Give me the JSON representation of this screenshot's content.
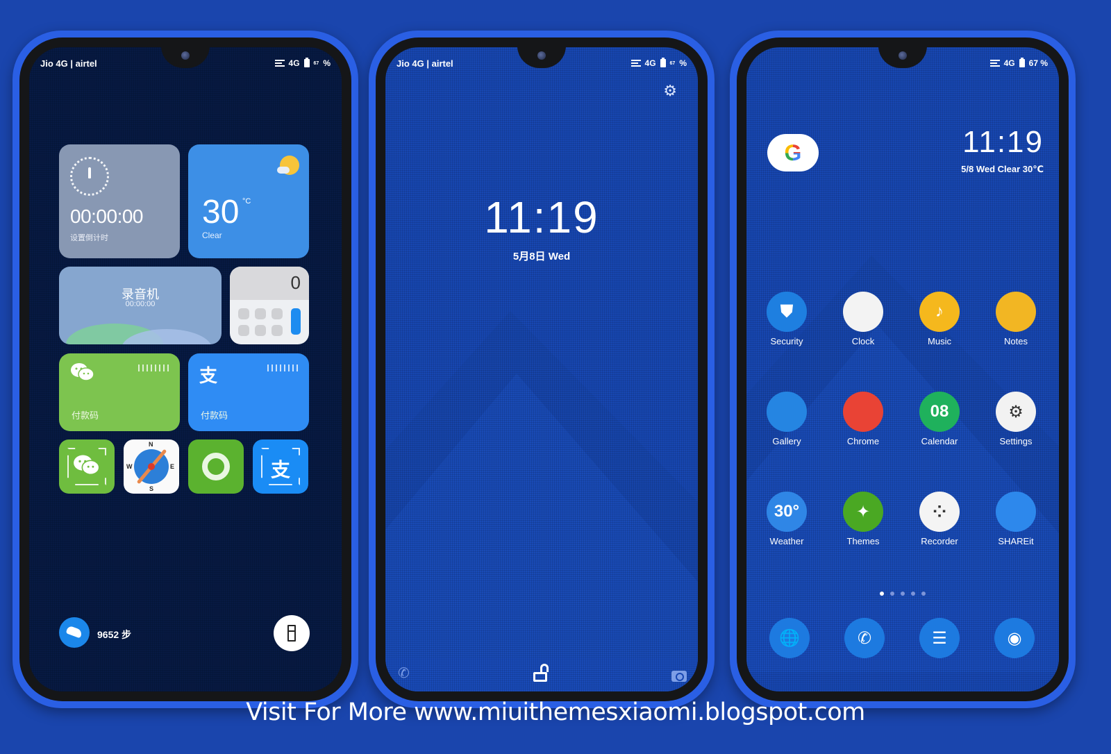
{
  "footer": {
    "text": "Visit For More www.miuithemesxiaomi.blogspot.com"
  },
  "colors": {
    "background": "#1a45ad",
    "phone_frame": "#2a5fe4",
    "widget_screen_bg": "#071a43",
    "wallpaper_blue": "#1747b2"
  },
  "phones": [
    {
      "name": "widgets",
      "statusbar": {
        "carrier": "Jio 4G | airtel",
        "network": "4G",
        "battery_small": "67",
        "battery_pct": "%"
      },
      "timer": {
        "time": "00:00:00",
        "label": "设置倒计时"
      },
      "weather": {
        "temp": "30",
        "unit": "°C",
        "condition": "Clear"
      },
      "recorder": {
        "title": "录音机",
        "time": "00:00:00"
      },
      "calculator": {
        "display": "0"
      },
      "wechat_pay": {
        "icon": "wechat-icon",
        "label": "付款码"
      },
      "alipay_pay": {
        "icon": "alipay-icon",
        "glyph": "支",
        "label": "付款码"
      },
      "shortcuts": [
        {
          "name": "wechat-scan",
          "icon": "wechat-icon"
        },
        {
          "name": "compass",
          "icon": "compass-icon",
          "letters": {
            "n": "N",
            "e": "E",
            "s": "S",
            "w": "W"
          }
        },
        {
          "name": "camera-shutter",
          "icon": "shutter-icon"
        },
        {
          "name": "alipay-scan",
          "icon": "alipay-icon",
          "glyph": "支"
        }
      ],
      "steps": {
        "count_text": "9652 步"
      },
      "flashlight": {
        "icon": "flashlight-icon"
      }
    },
    {
      "name": "lockscreen",
      "statusbar": {
        "carrier": "Jio 4G | airtel",
        "network": "4G",
        "battery_small": "67",
        "battery_pct": "%"
      },
      "settings_icon": "gear-icon",
      "time": "11:19",
      "date": "5月8日  Wed",
      "shortcuts": {
        "left": "phone-icon",
        "center": "unlock-icon",
        "right": "camera-icon"
      }
    },
    {
      "name": "homescreen",
      "statusbar": {
        "network": "4G",
        "battery": "67 %"
      },
      "google": {
        "letter": "G"
      },
      "clock": {
        "time": "11:19",
        "subline": "5/8  Wed  Clear 30℃"
      },
      "apps": [
        {
          "label": "Security",
          "icon": "shield-icon",
          "bg": "#1e7fe0",
          "glyph": "⛊"
        },
        {
          "label": "Clock",
          "icon": "clock-icon",
          "bg": "#f3f3f3",
          "glyph": ""
        },
        {
          "label": "Music",
          "icon": "music-note-icon",
          "bg": "#f5b81d",
          "glyph": "♪"
        },
        {
          "label": "Notes",
          "icon": "notes-bulb-icon",
          "bg": "#f2b623",
          "glyph": ""
        },
        {
          "label": "Gallery",
          "icon": "gallery-icon",
          "bg": "#2585e2",
          "glyph": ""
        },
        {
          "label": "Chrome",
          "icon": "chrome-icon",
          "bg": "#e94335",
          "glyph": ""
        },
        {
          "label": "Calendar",
          "icon": "calendar-icon",
          "bg": "#1fb15c",
          "glyph": "08"
        },
        {
          "label": "Settings",
          "icon": "settings-gear-icon",
          "bg": "#f2f2f2",
          "glyph": "⚙"
        },
        {
          "label": "Weather",
          "icon": "weather-sun-icon",
          "bg": "#2f86e6",
          "glyph": "30°"
        },
        {
          "label": "Themes",
          "icon": "magic-wand-icon",
          "bg": "#4aa823",
          "glyph": "✦"
        },
        {
          "label": "Recorder",
          "icon": "recorder-icon",
          "bg": "#f4f4f4",
          "glyph": "⁘"
        },
        {
          "label": "SHAREit",
          "icon": "shareit-icon",
          "bg": "#2d88ec",
          "glyph": ""
        }
      ],
      "page_indicator": {
        "pages": 5,
        "active": 1
      },
      "dock": [
        {
          "name": "browser",
          "icon": "globe-icon",
          "glyph": "🌐"
        },
        {
          "name": "phone",
          "icon": "phone-icon",
          "glyph": "✆"
        },
        {
          "name": "messages",
          "icon": "message-icon",
          "glyph": "☰"
        },
        {
          "name": "camera",
          "icon": "camera-icon",
          "glyph": "◉"
        }
      ]
    }
  ]
}
